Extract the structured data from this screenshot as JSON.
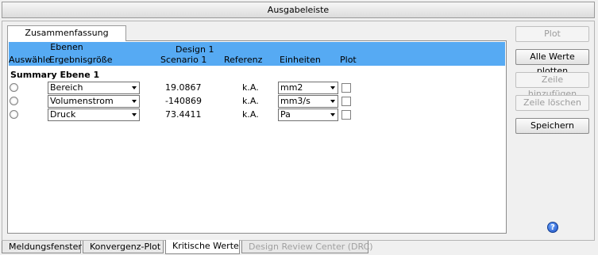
{
  "title": "Ausgabeleiste",
  "inner_tab": "Zusammenfassung Ebenen",
  "table": {
    "headers": {
      "select": "Auswähle",
      "result": "Ergebnisgröße",
      "design_line1": "Design 1",
      "design_line2": "Scenario 1",
      "reference": "Referenz",
      "units": "Einheiten",
      "plot": "Plot"
    },
    "group_label": "Summary Ebene 1",
    "rows": [
      {
        "quantity": "Bereich",
        "value": "19.0867",
        "reference": "k.A.",
        "unit": "mm2",
        "plot_checked": false
      },
      {
        "quantity": "Volumenstrom",
        "value": "-140869",
        "reference": "k.A.",
        "unit": "mm3/s",
        "plot_checked": false
      },
      {
        "quantity": "Druck",
        "value": "73.4411",
        "reference": "k.A.",
        "unit": "Pa",
        "plot_checked": false
      }
    ]
  },
  "buttons": {
    "plot": "Plot",
    "plot_all": "Alle Werte plotten",
    "add_row": "Zeile hinzufügen",
    "delete_row": "Zeile löschen",
    "save": "Speichern"
  },
  "help_icon": "?",
  "bottom_tabs": [
    "Meldungsfenster",
    "Konvergenz-Plot",
    "Kritische Werte",
    "Design Review Center (DRC)"
  ],
  "colors": {
    "header_bg": "#56aaf3",
    "help_icon": "#1c4fc2"
  }
}
